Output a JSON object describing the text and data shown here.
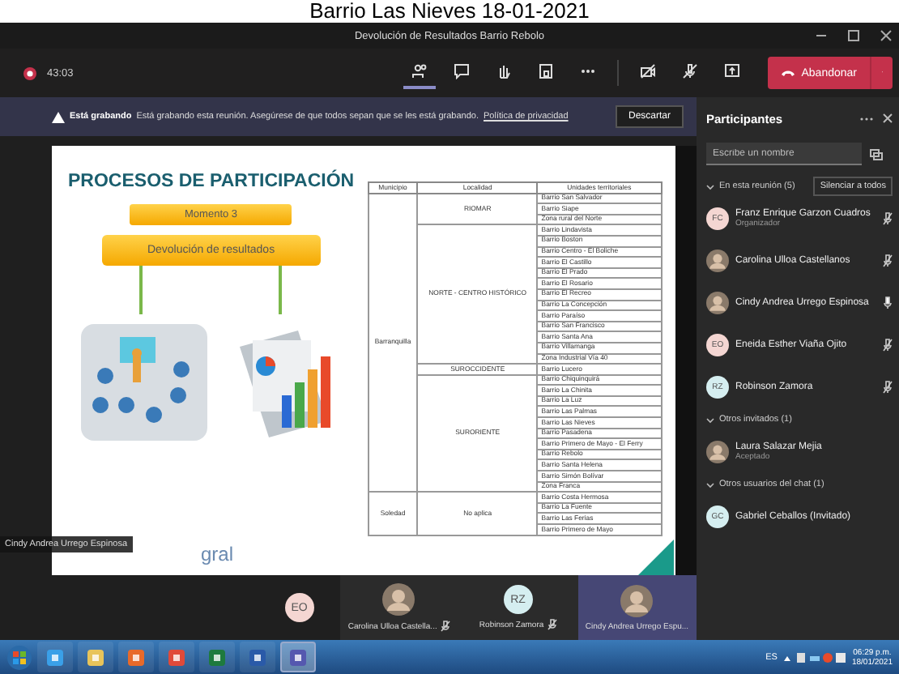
{
  "caption": "Barrio Las Nieves 18-01-2021",
  "window": {
    "title": "Devolución de Resultados Barrio Rebolo"
  },
  "toolbar": {
    "timer": "43:03",
    "tools": [
      {
        "kind": "participants",
        "selected": true
      },
      {
        "kind": "chat",
        "selected": false
      },
      {
        "kind": "hand",
        "selected": false
      },
      {
        "kind": "rooms",
        "selected": false
      },
      {
        "kind": "more",
        "selected": false
      }
    ],
    "devices": [
      {
        "kind": "camera",
        "on": false
      },
      {
        "kind": "mic",
        "on": false
      },
      {
        "kind": "share",
        "on": false
      }
    ],
    "leave": "Abandonar"
  },
  "banner": {
    "title": "Está grabando",
    "message": "Está grabando esta reunión. Asegúrese de que todos sepan que se les está grabando.",
    "link": "Política de privacidad",
    "dismiss": "Descartar"
  },
  "slide": {
    "title": "PROCESOS DE PARTICIPACIÓN",
    "step": "Momento 3",
    "heading": "Devolución de resultados",
    "logo_text": "gral",
    "table": {
      "columns": [
        "Municipio",
        "Localidad",
        "Unidades territoriales"
      ],
      "groups": [
        {
          "name": "Barranquilla",
          "localities": [
            {
              "name": "RIOMAR",
              "units": [
                "Barrio San Salvador",
                "Barrio Siape",
                "Zona rural del Norte"
              ]
            },
            {
              "name": "NORTE - CENTRO HISTÓRICO",
              "units": [
                "Barrio Lindavista",
                "Barrio Boston",
                "Barrio Centro - El Boliche",
                "Barrio El Castillo",
                "Barrio El Prado",
                "Barrio El Rosario",
                "Barrio El Recreo",
                "Barrio La Concepción",
                "Barrio Paraíso",
                "Barrio San Francisco",
                "Barrio Santa Ana",
                "Barrio Villamanga",
                "Zona Industrial Vía 40"
              ]
            },
            {
              "name": "SUROCCIDENTE",
              "units": [
                "Barrio Lucero"
              ]
            },
            {
              "name": "SURORIENTE",
              "units": [
                "Barrio Chiquinquirá",
                "Barrio La Chinita",
                "Barrio La Luz",
                "Barrio Las Palmas",
                "Barrio Las Nieves",
                "Barrio Pasadena",
                "Barrio Primero de Mayo - El Ferry",
                "Barrio Rebolo",
                "Barrio Santa Helena",
                "Barrio Simón Bolívar",
                "Zona Franca"
              ]
            }
          ]
        },
        {
          "name": "Soledad",
          "localities": [
            {
              "name": "No aplica",
              "units": [
                "Barrio Costa Hermosa",
                "Barrio La Fuente",
                "Barrio Las Ferias",
                "Barrio Primero de Mayo"
              ]
            }
          ]
        }
      ]
    }
  },
  "presenter_tag": "Cindy Andrea Urrego Espinosa",
  "tiles": [
    {
      "kind": "initials",
      "initials": "EO",
      "color": "#f4d6d2"
    },
    {
      "kind": "photo",
      "name": "Carolina Ulloa Castella...",
      "muted": true,
      "selected": false
    },
    {
      "kind": "initials",
      "initials": "RZ",
      "color": "#d5eef0",
      "name": "Robinson Zamora",
      "muted": true,
      "selected": false
    },
    {
      "kind": "photo",
      "name": "Cindy Andrea Urrego Espu...",
      "muted": false,
      "selected": true
    }
  ],
  "panel": {
    "title": "Participantes",
    "search": {
      "placeholder": "Escribe un nombre"
    },
    "sections": [
      {
        "title": "En esta reunión (5)",
        "expanded": true,
        "action": "Silenciar a todos",
        "people": [
          {
            "name": "Franz Enrique Garzon Cuadros",
            "role": "Organizador",
            "kind": "initials",
            "initials": "FC",
            "color": "#f4d6d2",
            "muted": true
          },
          {
            "name": "Carolina Ulloa Castellanos",
            "kind": "photo",
            "muted": true
          },
          {
            "name": "Cindy Andrea Urrego Espinosa",
            "kind": "photo",
            "muted": false
          },
          {
            "name": "Eneida Esther Viaña Ojito",
            "kind": "initials",
            "initials": "EO",
            "color": "#f4d6d2",
            "muted": true
          },
          {
            "name": "Robinson Zamora",
            "kind": "initials",
            "initials": "RZ",
            "color": "#d5eef0",
            "muted": true
          }
        ]
      },
      {
        "title": "Otros invitados (1)",
        "expanded": true,
        "people": [
          {
            "name": "Laura Salazar Mejia",
            "role": "Aceptado",
            "kind": "photo"
          }
        ]
      },
      {
        "title": "Otros usuarios del chat (1)",
        "expanded": true,
        "people": [
          {
            "name": "Gabriel Ceballos (Invitado)",
            "kind": "initials",
            "initials": "GC",
            "color": "#d5eef0"
          }
        ]
      }
    ]
  },
  "taskbar": {
    "apps": [
      {
        "kind": "ie",
        "selected": false
      },
      {
        "kind": "folder",
        "selected": false
      },
      {
        "kind": "media",
        "selected": false
      },
      {
        "kind": "chrome",
        "selected": false
      },
      {
        "kind": "excel",
        "selected": false
      },
      {
        "kind": "word",
        "selected": false
      },
      {
        "kind": "teams",
        "selected": true
      }
    ],
    "language": "ES",
    "time": "06:29 p.m.",
    "date": "18/01/2021"
  }
}
